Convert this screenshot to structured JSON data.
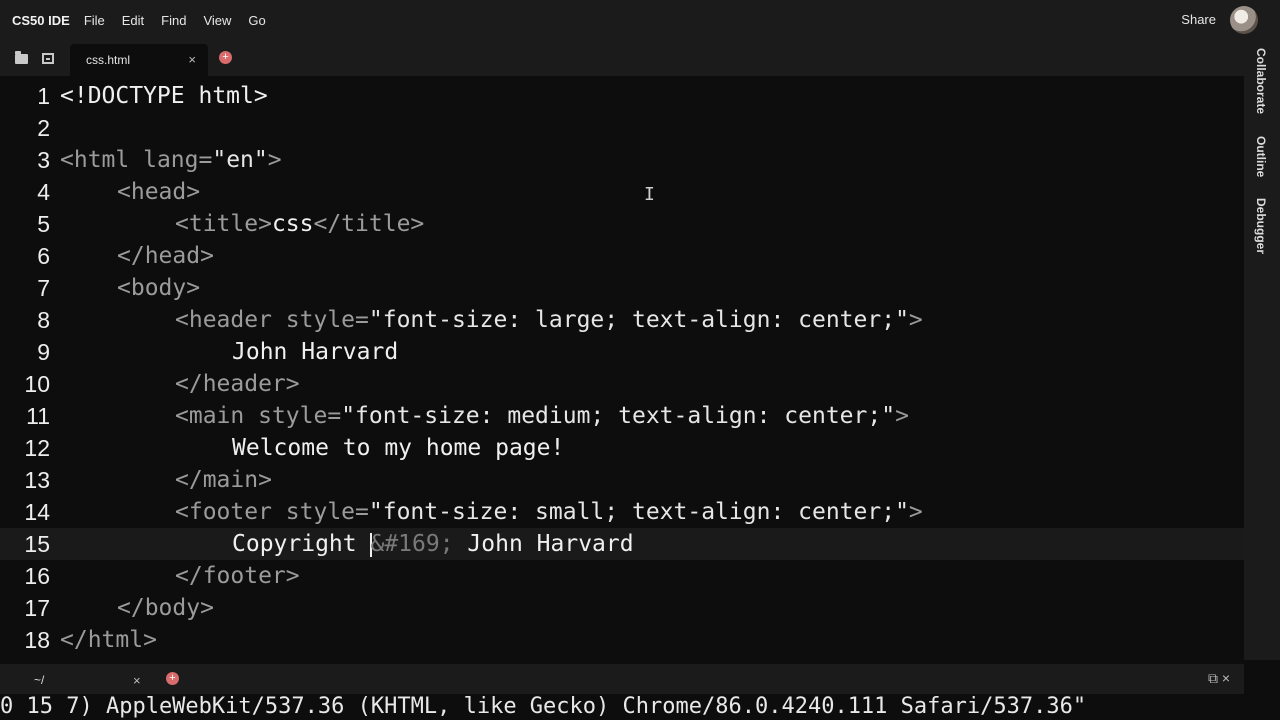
{
  "menubar": {
    "brand": "CS50 IDE",
    "items": [
      "File",
      "Edit",
      "Find",
      "View",
      "Go"
    ],
    "share_label": "Share"
  },
  "tabs": {
    "active_file": "css.html",
    "close_glyph": "×",
    "add_glyph": "+"
  },
  "rightbar": {
    "labels": [
      "Collaborate",
      "Outline",
      "Debugger"
    ]
  },
  "editor": {
    "line_numbers": [
      "1",
      "2",
      "3",
      "4",
      "5",
      "6",
      "7",
      "8",
      "9",
      "10",
      "11",
      "12",
      "13",
      "14",
      "15",
      "16",
      "17",
      "18"
    ],
    "active_line": 15,
    "lines": [
      {
        "tag_open": "<!DOCTYPE html>"
      },
      {},
      {
        "tag_open": "<html ",
        "attr": "lang=",
        "str": "\"en\"",
        "tag_close": ">"
      },
      {
        "tag_open": "<head>"
      },
      {
        "tag_open": "<title>",
        "text": "css",
        "tag_close": "</title>"
      },
      {
        "tag_open": "</head>"
      },
      {
        "tag_open": "<body>"
      },
      {
        "tag_open": "<header ",
        "attr": "style=",
        "str": "\"font-size: large; text-align: center;\"",
        "tag_close": ">"
      },
      {
        "text": "John Harvard"
      },
      {
        "tag_open": "</header>"
      },
      {
        "tag_open": "<main ",
        "attr": "style=",
        "str": "\"font-size: medium; text-align: center;\"",
        "tag_close": ">"
      },
      {
        "text": "Welcome to my home page!"
      },
      {
        "tag_open": "</main>"
      },
      {
        "tag_open": "<footer ",
        "attr": "style=",
        "str": "\"font-size: small; text-align: center;\"",
        "tag_close": ">"
      },
      {
        "text": "Copyright ",
        "entity": "&#169;",
        "text2": " John Harvard"
      },
      {
        "tag_open": "</footer>"
      },
      {
        "tag_open": "</body>"
      },
      {
        "tag_open": "</html>"
      }
    ]
  },
  "terminal": {
    "tab_label": "~/",
    "close_glyph": "×",
    "add_glyph": "+",
    "output": "0 15 7) AppleWebKit/537.36 (KHTML, like Gecko) Chrome/86.0.4240.111 Safari/537.36\""
  },
  "icons": {
    "folder": "folder-icon",
    "file_tree": "file-tree-icon",
    "avatar": "user-avatar",
    "mouse_cursor": "text-cursor-icon"
  },
  "colors": {
    "background": "#0d0d0d",
    "chrome": "#1b1b1b",
    "add_button": "#d86b6b"
  }
}
